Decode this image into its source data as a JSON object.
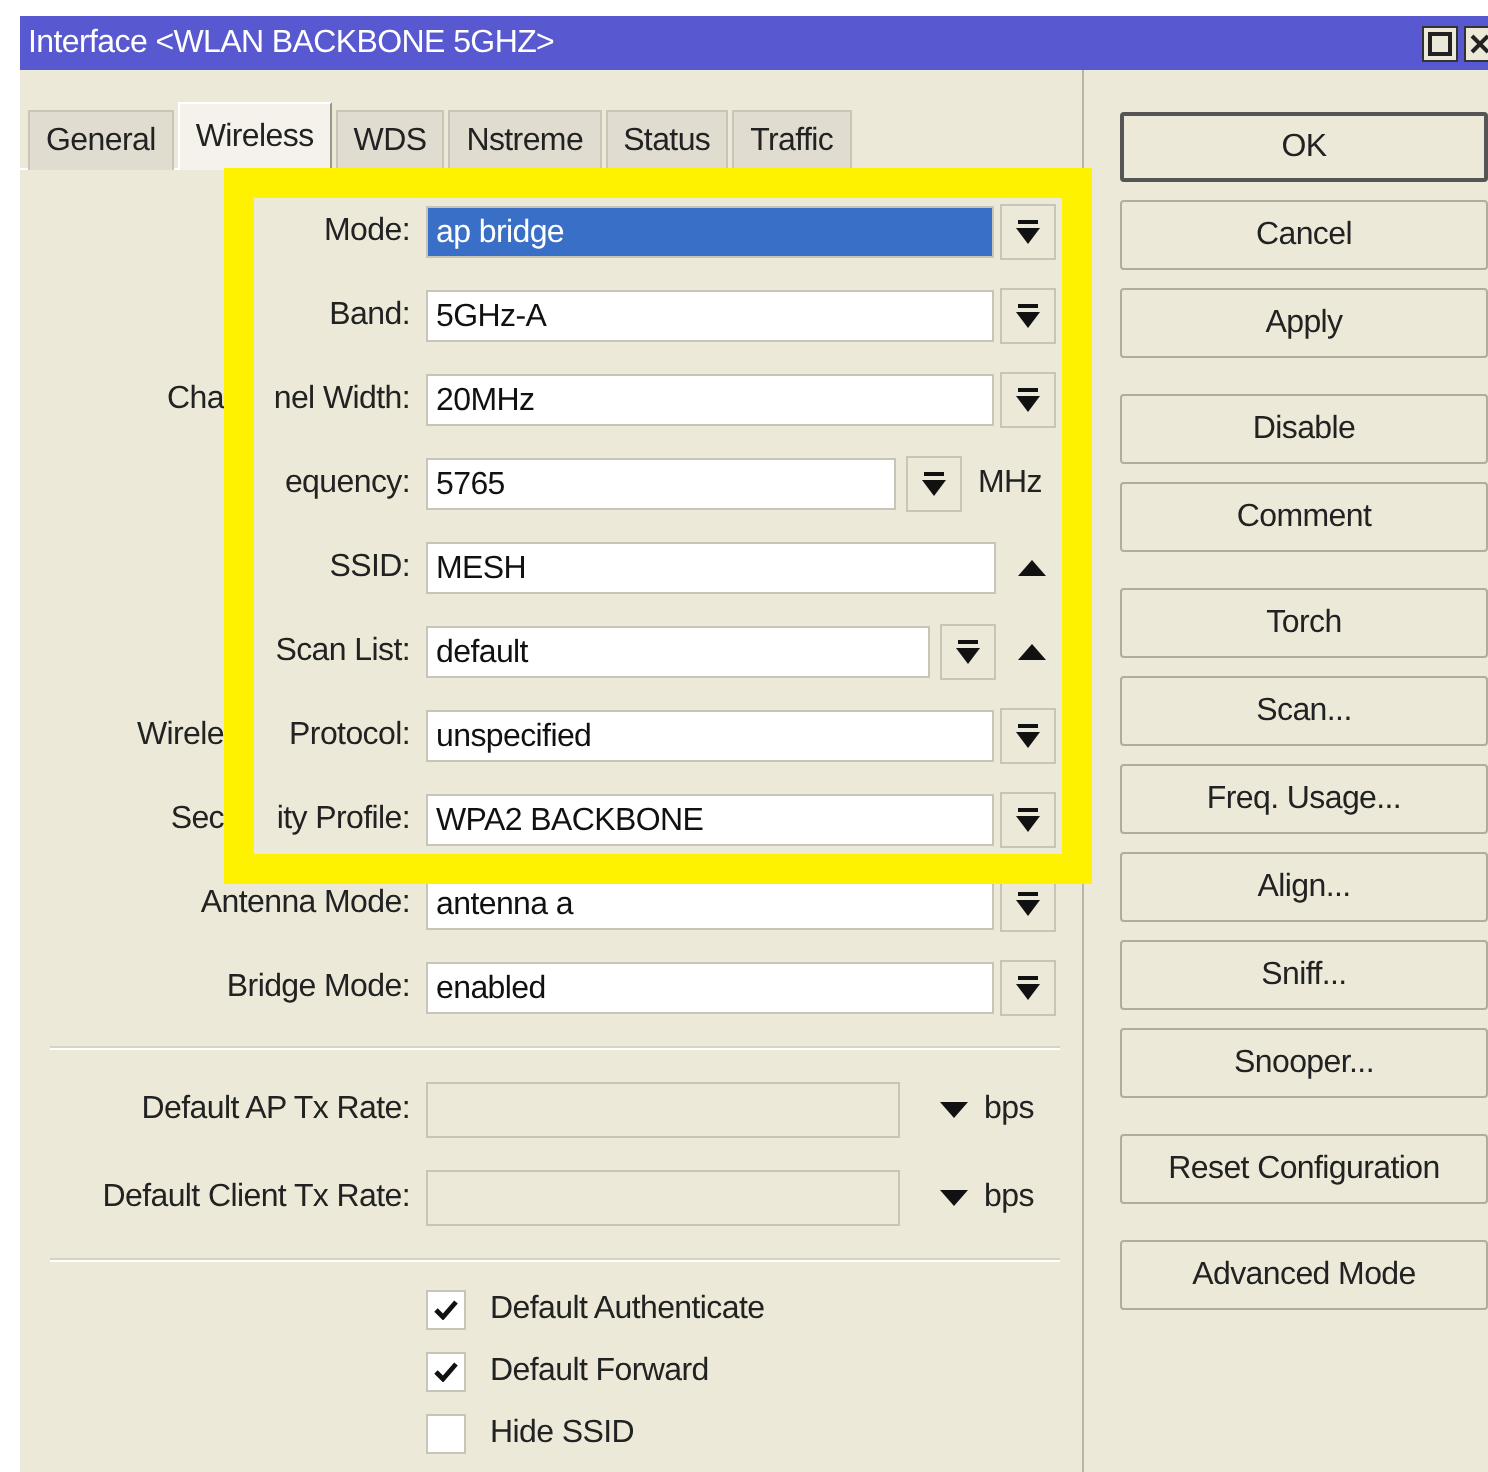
{
  "window": {
    "title": "Interface <WLAN BACKBONE 5GHZ>"
  },
  "tabs": [
    {
      "label": "General",
      "selected": false
    },
    {
      "label": "Wireless",
      "selected": true
    },
    {
      "label": "WDS",
      "selected": false
    },
    {
      "label": "Nstreme",
      "selected": false
    },
    {
      "label": "Status",
      "selected": false
    },
    {
      "label": "Traffic",
      "selected": false
    }
  ],
  "fields": [
    {
      "kind": "dropdown",
      "label": [
        "Mode:"
      ],
      "value": "ap bridge",
      "highlighted": true
    },
    {
      "kind": "dropdown",
      "label": [
        "Band:"
      ],
      "value": "5GHz-A",
      "highlighted": false
    },
    {
      "kind": "dropdown",
      "label": [
        "Cha",
        "nel Width:"
      ],
      "value": "20MHz",
      "highlighted": false
    },
    {
      "kind": "dropdown_unit",
      "label": [
        "equency:"
      ],
      "value": "5765",
      "unit": "MHz",
      "highlighted": false
    },
    {
      "kind": "text_up",
      "label": [
        "SSID:"
      ],
      "value": "MESH",
      "highlighted": false
    },
    {
      "kind": "dropdown_up",
      "label": [
        "Scan List:"
      ],
      "value": "default",
      "highlighted": false
    },
    {
      "kind": "dropdown",
      "label": [
        "Wirele",
        "Protocol:"
      ],
      "value": "unspecified",
      "highlighted": false
    },
    {
      "kind": "dropdown",
      "label": [
        "Sec",
        "ity Profile:"
      ],
      "value": "WPA2 BACKBONE",
      "highlighted": false
    },
    {
      "kind": "dropdown",
      "label": [
        "Antenna Mode:"
      ],
      "value": "antenna a",
      "highlighted": false
    },
    {
      "kind": "dropdown",
      "label": [
        "Bridge Mode:"
      ],
      "value": "enabled",
      "highlighted": false
    }
  ],
  "rates": [
    {
      "label": "Default AP Tx Rate:",
      "unit": "bps"
    },
    {
      "label": "Default Client Tx Rate:",
      "unit": "bps"
    }
  ],
  "checkboxes": [
    {
      "label": "Default Authenticate",
      "checked": true
    },
    {
      "label": "Default Forward",
      "checked": true
    },
    {
      "label": "Hide SSID",
      "checked": false
    }
  ],
  "buttons": [
    [
      {
        "label": "OK",
        "default": true
      },
      {
        "label": "Cancel",
        "default": false
      },
      {
        "label": "Apply",
        "default": false
      }
    ],
    [
      {
        "label": "Disable",
        "default": false
      },
      {
        "label": "Comment",
        "default": false
      }
    ],
    [
      {
        "label": "Torch",
        "default": false
      },
      {
        "label": "Scan...",
        "default": false
      },
      {
        "label": "Freq. Usage...",
        "default": false
      },
      {
        "label": "Align...",
        "default": false
      },
      {
        "label": "Sniff...",
        "default": false
      },
      {
        "label": "Snooper...",
        "default": false
      }
    ],
    [
      {
        "label": "Reset Configuration",
        "default": false
      }
    ],
    [
      {
        "label": "Advanced Mode",
        "default": false
      }
    ]
  ]
}
